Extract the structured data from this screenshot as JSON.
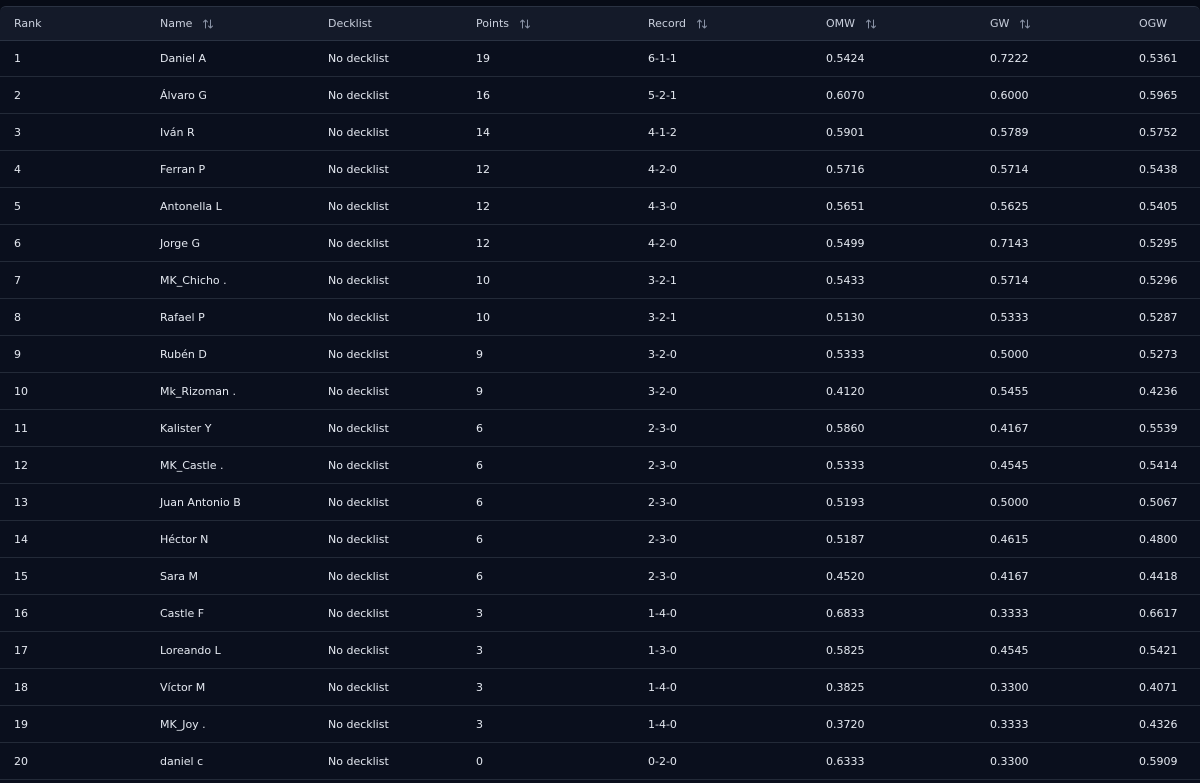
{
  "colors": {
    "background": "#070b16",
    "header_background": "#141a29",
    "row_divider": "#232a38",
    "text": "#e3e7ef"
  },
  "table": {
    "headers": {
      "rank": "Rank",
      "name": "Name",
      "decklist": "Decklist",
      "points": "Points",
      "record": "Record",
      "omw": "OMW",
      "gw": "GW",
      "ogw": "OGW"
    },
    "sort_icon": "sort-arrows-icon",
    "rows": [
      {
        "rank": "1",
        "name": "Daniel A",
        "decklist": "No decklist",
        "points": "19",
        "record": "6-1-1",
        "omw": "0.5424",
        "gw": "0.7222",
        "ogw": "0.5361"
      },
      {
        "rank": "2",
        "name": "Álvaro G",
        "decklist": "No decklist",
        "points": "16",
        "record": "5-2-1",
        "omw": "0.6070",
        "gw": "0.6000",
        "ogw": "0.5965"
      },
      {
        "rank": "3",
        "name": "Iván R",
        "decklist": "No decklist",
        "points": "14",
        "record": "4-1-2",
        "omw": "0.5901",
        "gw": "0.5789",
        "ogw": "0.5752"
      },
      {
        "rank": "4",
        "name": "Ferran P",
        "decklist": "No decklist",
        "points": "12",
        "record": "4-2-0",
        "omw": "0.5716",
        "gw": "0.5714",
        "ogw": "0.5438"
      },
      {
        "rank": "5",
        "name": "Antonella L",
        "decklist": "No decklist",
        "points": "12",
        "record": "4-3-0",
        "omw": "0.5651",
        "gw": "0.5625",
        "ogw": "0.5405"
      },
      {
        "rank": "6",
        "name": "Jorge G",
        "decklist": "No decklist",
        "points": "12",
        "record": "4-2-0",
        "omw": "0.5499",
        "gw": "0.7143",
        "ogw": "0.5295"
      },
      {
        "rank": "7",
        "name": "MK_Chicho .",
        "decklist": "No decklist",
        "points": "10",
        "record": "3-2-1",
        "omw": "0.5433",
        "gw": "0.5714",
        "ogw": "0.5296"
      },
      {
        "rank": "8",
        "name": "Rafael P",
        "decklist": "No decklist",
        "points": "10",
        "record": "3-2-1",
        "omw": "0.5130",
        "gw": "0.5333",
        "ogw": "0.5287"
      },
      {
        "rank": "9",
        "name": "Rubén D",
        "decklist": "No decklist",
        "points": "9",
        "record": "3-2-0",
        "omw": "0.5333",
        "gw": "0.5000",
        "ogw": "0.5273"
      },
      {
        "rank": "10",
        "name": "Mk_Rizoman .",
        "decklist": "No decklist",
        "points": "9",
        "record": "3-2-0",
        "omw": "0.4120",
        "gw": "0.5455",
        "ogw": "0.4236"
      },
      {
        "rank": "11",
        "name": "Kalister Y",
        "decklist": "No decklist",
        "points": "6",
        "record": "2-3-0",
        "omw": "0.5860",
        "gw": "0.4167",
        "ogw": "0.5539"
      },
      {
        "rank": "12",
        "name": "MK_Castle .",
        "decklist": "No decklist",
        "points": "6",
        "record": "2-3-0",
        "omw": "0.5333",
        "gw": "0.4545",
        "ogw": "0.5414"
      },
      {
        "rank": "13",
        "name": "Juan Antonio B",
        "decklist": "No decklist",
        "points": "6",
        "record": "2-3-0",
        "omw": "0.5193",
        "gw": "0.5000",
        "ogw": "0.5067"
      },
      {
        "rank": "14",
        "name": "Héctor N",
        "decklist": "No decklist",
        "points": "6",
        "record": "2-3-0",
        "omw": "0.5187",
        "gw": "0.4615",
        "ogw": "0.4800"
      },
      {
        "rank": "15",
        "name": "Sara M",
        "decklist": "No decklist",
        "points": "6",
        "record": "2-3-0",
        "omw": "0.4520",
        "gw": "0.4167",
        "ogw": "0.4418"
      },
      {
        "rank": "16",
        "name": "Castle F",
        "decklist": "No decklist",
        "points": "3",
        "record": "1-4-0",
        "omw": "0.6833",
        "gw": "0.3333",
        "ogw": "0.6617"
      },
      {
        "rank": "17",
        "name": "Loreando L",
        "decklist": "No decklist",
        "points": "3",
        "record": "1-3-0",
        "omw": "0.5825",
        "gw": "0.4545",
        "ogw": "0.5421"
      },
      {
        "rank": "18",
        "name": "Víctor M",
        "decklist": "No decklist",
        "points": "3",
        "record": "1-4-0",
        "omw": "0.3825",
        "gw": "0.3300",
        "ogw": "0.4071"
      },
      {
        "rank": "19",
        "name": "MK_Joy .",
        "decklist": "No decklist",
        "points": "3",
        "record": "1-4-0",
        "omw": "0.3720",
        "gw": "0.3333",
        "ogw": "0.4326"
      },
      {
        "rank": "20",
        "name": "daniel c",
        "decklist": "No decklist",
        "points": "0",
        "record": "0-2-0",
        "omw": "0.6333",
        "gw": "0.3300",
        "ogw": "0.5909"
      }
    ]
  }
}
